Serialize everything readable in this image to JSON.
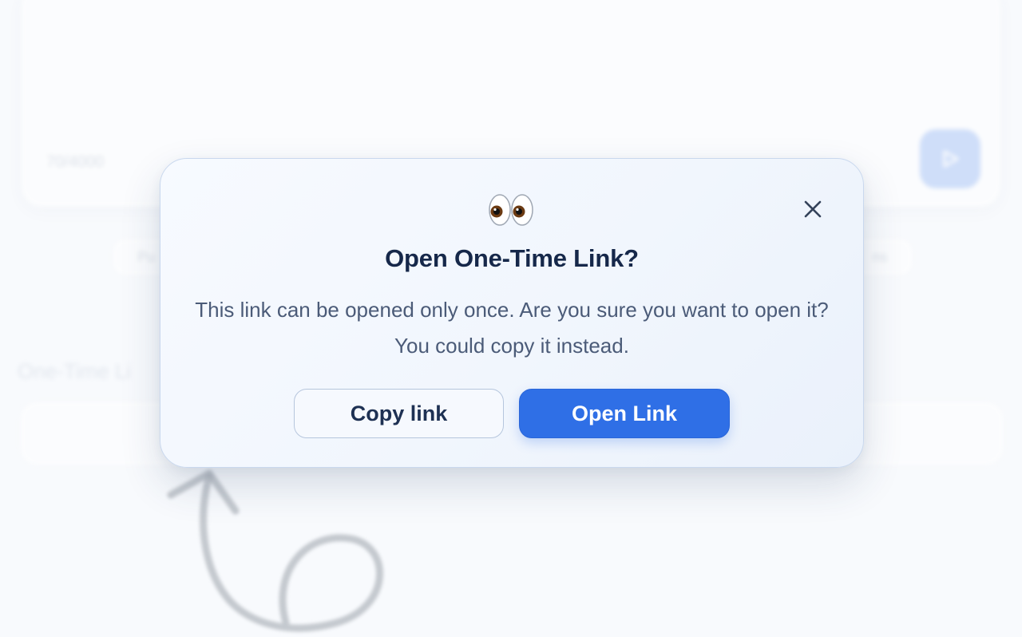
{
  "background": {
    "char_counter": "70/4000",
    "section_label": "One-Time Li",
    "chip_left_text": "Pu",
    "chip_right_text": "ns"
  },
  "dialog": {
    "emoji": "👀",
    "title": "Open One-Time Link?",
    "body": "This link can be opened only once. Are you sure you want to open it? You could copy it instead.",
    "copy_label": "Copy link",
    "open_label": "Open Link",
    "close_icon": "close-icon"
  },
  "colors": {
    "accent": "#2f6fe6",
    "title": "#16284a",
    "body_text": "#4b5b78"
  }
}
